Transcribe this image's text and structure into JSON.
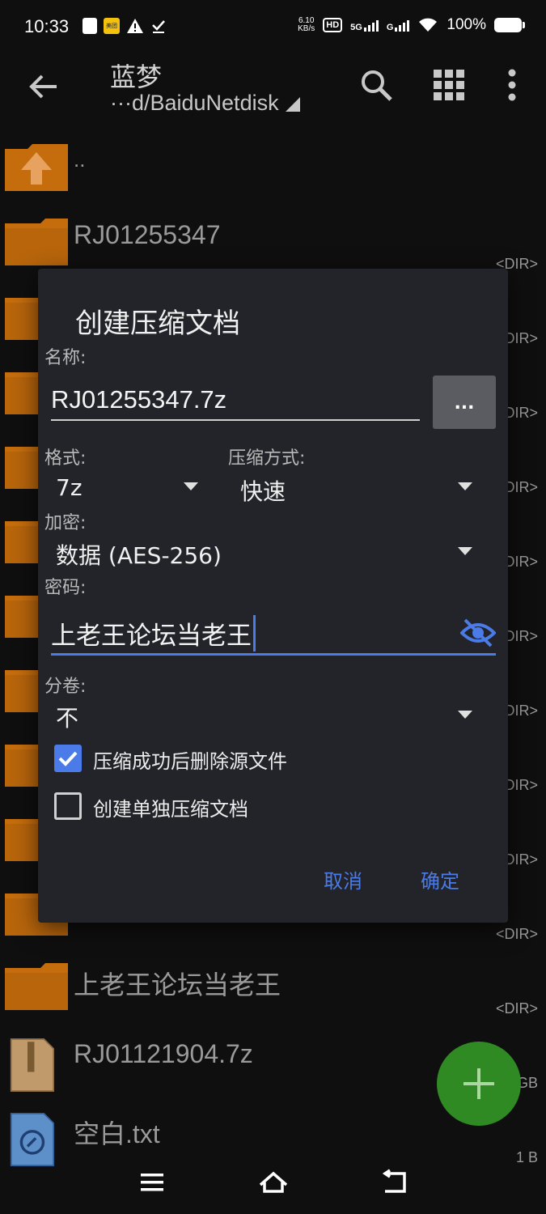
{
  "status_bar": {
    "time": "10:33",
    "badge_text": "美团",
    "net_speed_top": "6.10",
    "net_speed_bottom": "KB/s",
    "hd": "HD",
    "network_5g": "5G",
    "network_g": "G",
    "battery": "100%"
  },
  "app_bar": {
    "title": "蓝梦",
    "path": "···d/BaiduNetdisk"
  },
  "files": [
    {
      "name": "..",
      "meta": "",
      "type": "up"
    },
    {
      "name": "RJ01255347",
      "meta": "<DIR>",
      "type": "folder"
    },
    {
      "name": "",
      "meta": "<DIR>",
      "type": "folder"
    },
    {
      "name": "",
      "meta": "<DIR>",
      "type": "folder"
    },
    {
      "name": "",
      "meta": "<DIR>",
      "type": "folder"
    },
    {
      "name": "",
      "meta": "<DIR>",
      "type": "folder"
    },
    {
      "name": "",
      "meta": "<DIR>",
      "type": "folder"
    },
    {
      "name": "",
      "meta": "<DIR>",
      "type": "folder"
    },
    {
      "name": "",
      "meta": "<DIR>",
      "type": "folder"
    },
    {
      "name": "",
      "meta": "<DIR>",
      "type": "folder"
    },
    {
      "name": "",
      "meta": "<DIR>",
      "type": "folder"
    },
    {
      "name": "上老王论坛当老王",
      "meta": "<DIR>",
      "type": "folder"
    },
    {
      "name": "RJ01121904.7z",
      "meta": "GB",
      "type": "archive"
    },
    {
      "name": "空白.txt",
      "meta": "1 B",
      "type": "text"
    }
  ],
  "dialog": {
    "title": "创建压缩文档",
    "name_label": "名称:",
    "name_value": "RJ01255347.7z",
    "browse_label": "...",
    "format_label": "格式:",
    "format_value": "7z",
    "method_label": "压缩方式:",
    "method_value": "快速",
    "encryption_label": "加密:",
    "encryption_value": "数据 (AES-256)",
    "password_label": "密码:",
    "password_value": "上老王论坛当老王",
    "split_label": "分卷:",
    "split_value": "不",
    "delete_source_label": "压缩成功后删除源文件",
    "delete_source_checked": true,
    "separate_label": "创建单独压缩文档",
    "separate_checked": false,
    "cancel_label": "取消",
    "ok_label": "确定"
  },
  "colors": {
    "accent": "#4a7be8",
    "folder": "#c56d0d",
    "fab": "#2f8a24",
    "dialog_bg": "#232429"
  }
}
